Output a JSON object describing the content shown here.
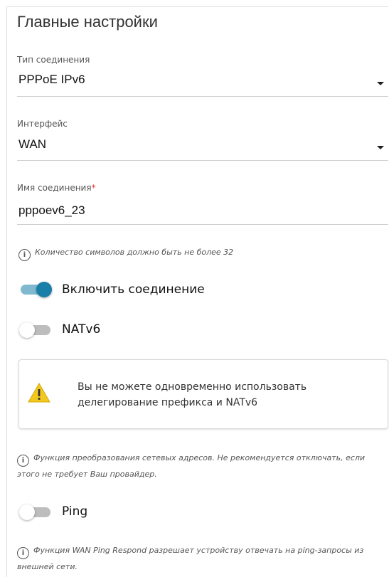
{
  "section": {
    "title": "Главные настройки"
  },
  "connection_type": {
    "label": "Тип соединения",
    "value": "PPPoE IPv6"
  },
  "interface": {
    "label": "Интерфейс",
    "value": "WAN"
  },
  "connection_name": {
    "label": "Имя соединения",
    "required_mark": "*",
    "value": "pppoev6_23",
    "hint": "Количество символов должно быть не более 32"
  },
  "enable_connection": {
    "label": "Включить соединение",
    "state": "on"
  },
  "natv6": {
    "label": "NATv6",
    "state": "off",
    "warning": "Вы не можете одновременно использовать делегирование префикса и NATv6",
    "hint": "Функция преобразования сетевых адресов. Не рекомендуется отключать, если этого не требует Ваш провайдер."
  },
  "ping": {
    "label": "Ping",
    "state": "off",
    "hint": "Функция WAN Ping Respond разрешает устройству отвечать на ping-запросы из внешней сети."
  },
  "icons": {
    "info": "info-icon",
    "warning": "warning-icon",
    "dropdown": "caret-down-icon"
  },
  "colors": {
    "accent": "#1a7fa8",
    "accent_track": "#7fb9d0",
    "required": "#e53935",
    "warning": "#f2c81e"
  }
}
